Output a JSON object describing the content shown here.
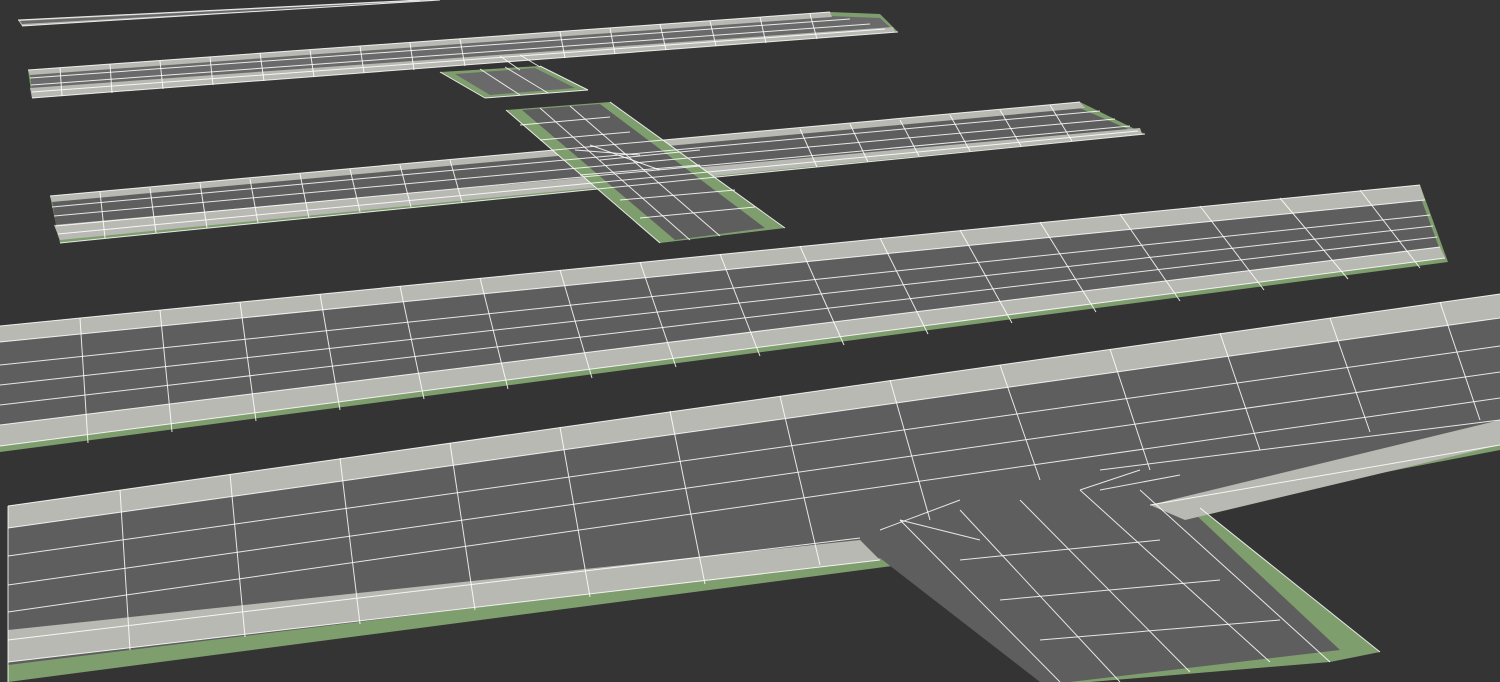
{
  "viewport": {
    "background_color": "#343434",
    "grid_color": "#ffffff"
  },
  "materials": {
    "grass_color": "#7f9e6e",
    "curb_color": "#b9b9b3",
    "asphalt_color": "#5e5e5e"
  },
  "scene": {
    "description_visible_text": "",
    "road_pieces": [
      {
        "kind": "straight-road",
        "lanes": 1
      },
      {
        "kind": "t-junction",
        "lanes": 1
      },
      {
        "kind": "four-way-intersection",
        "lanes": 1
      },
      {
        "kind": "straight-road",
        "lanes": 2
      },
      {
        "kind": "t-junction",
        "lanes": 2
      }
    ]
  }
}
